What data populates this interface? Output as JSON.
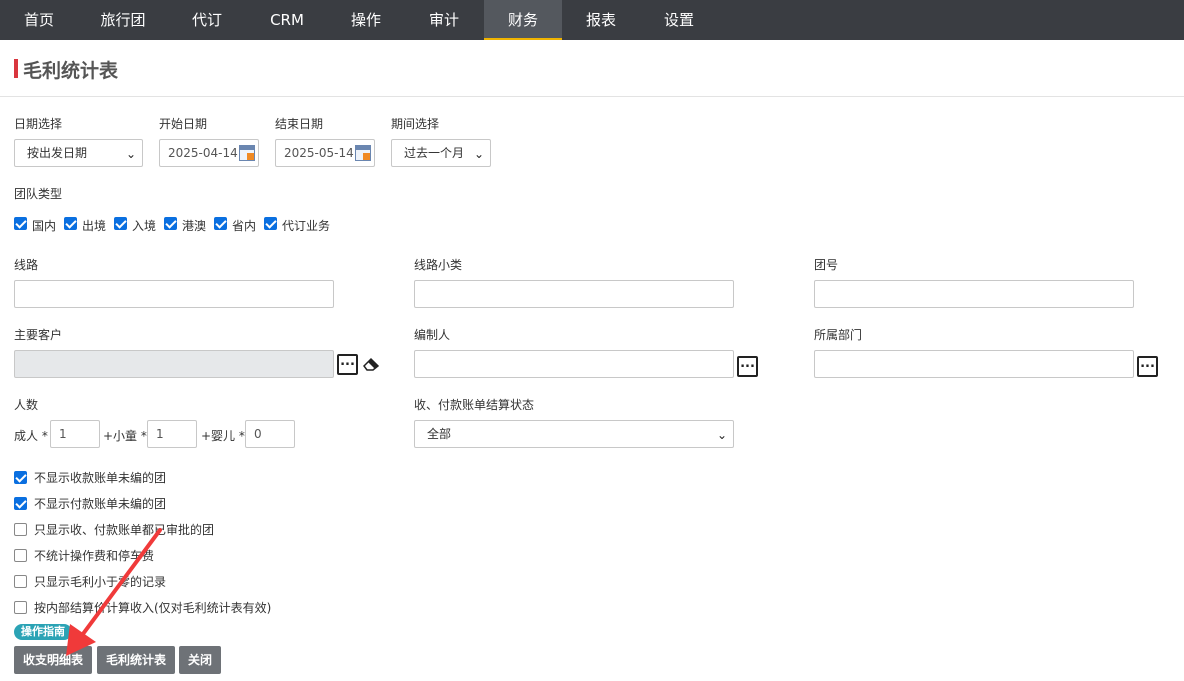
{
  "nav": {
    "items": [
      {
        "label": "首页"
      },
      {
        "label": "旅行团"
      },
      {
        "label": "代订"
      },
      {
        "label": "CRM"
      },
      {
        "label": "操作"
      },
      {
        "label": "审计"
      },
      {
        "label": "财务"
      },
      {
        "label": "报表"
      },
      {
        "label": "设置"
      }
    ],
    "active": "财务"
  },
  "page_title": "毛利统计表",
  "form": {
    "date_select": {
      "label": "日期选择",
      "value": "按出发日期"
    },
    "start_date": {
      "label": "开始日期",
      "value": "2025-04-14"
    },
    "end_date": {
      "label": "结束日期",
      "value": "2025-05-14"
    },
    "period": {
      "label": "期间选择",
      "value": "过去一个月"
    },
    "team_type": {
      "label": "团队类型",
      "options": [
        {
          "label": "国内",
          "checked": true
        },
        {
          "label": "出境",
          "checked": true
        },
        {
          "label": "入境",
          "checked": true
        },
        {
          "label": "港澳",
          "checked": true
        },
        {
          "label": "省内",
          "checked": true
        },
        {
          "label": "代订业务",
          "checked": true
        }
      ]
    },
    "route": {
      "label": "线路",
      "value": ""
    },
    "route_sub": {
      "label": "线路小类",
      "value": ""
    },
    "group_no": {
      "label": "团号",
      "value": ""
    },
    "main_customer": {
      "label": "主要客户",
      "value": ""
    },
    "editor": {
      "label": "编制人",
      "value": ""
    },
    "department": {
      "label": "所属部门",
      "value": ""
    },
    "people": {
      "label": "人数",
      "adult_label": "成人 *",
      "adult_value": "1",
      "child_label": "+小童 *",
      "child_value": "1",
      "infant_label": "+婴儿 *",
      "infant_value": "0"
    },
    "settle_status": {
      "label": "收、付款账单结算状态",
      "value": "全部"
    },
    "options": [
      {
        "label": "不显示收款账单未编的团",
        "checked": true
      },
      {
        "label": "不显示付款账单未编的团",
        "checked": true
      },
      {
        "label": "只显示收、付款账单都已审批的团",
        "checked": false
      },
      {
        "label": "不统计操作费和停车费",
        "checked": false
      },
      {
        "label": "只显示毛利小于零的记录",
        "checked": false
      },
      {
        "label": "按内部结算价计算收入(仅对毛利统计表有效)",
        "checked": false
      }
    ]
  },
  "guide_badge": "操作指南",
  "buttons": {
    "detail": "收支明细表",
    "profit": "毛利统计表",
    "close": "关闭"
  },
  "colors": {
    "nav_bg": "#3a3d42",
    "active_underline": "#f0b400",
    "title_mark": "#d9363e",
    "checkbox": "#0a6fe0",
    "button": "#6e7277",
    "badge": "#2ba3b5",
    "arrow": "#f03a3a"
  }
}
